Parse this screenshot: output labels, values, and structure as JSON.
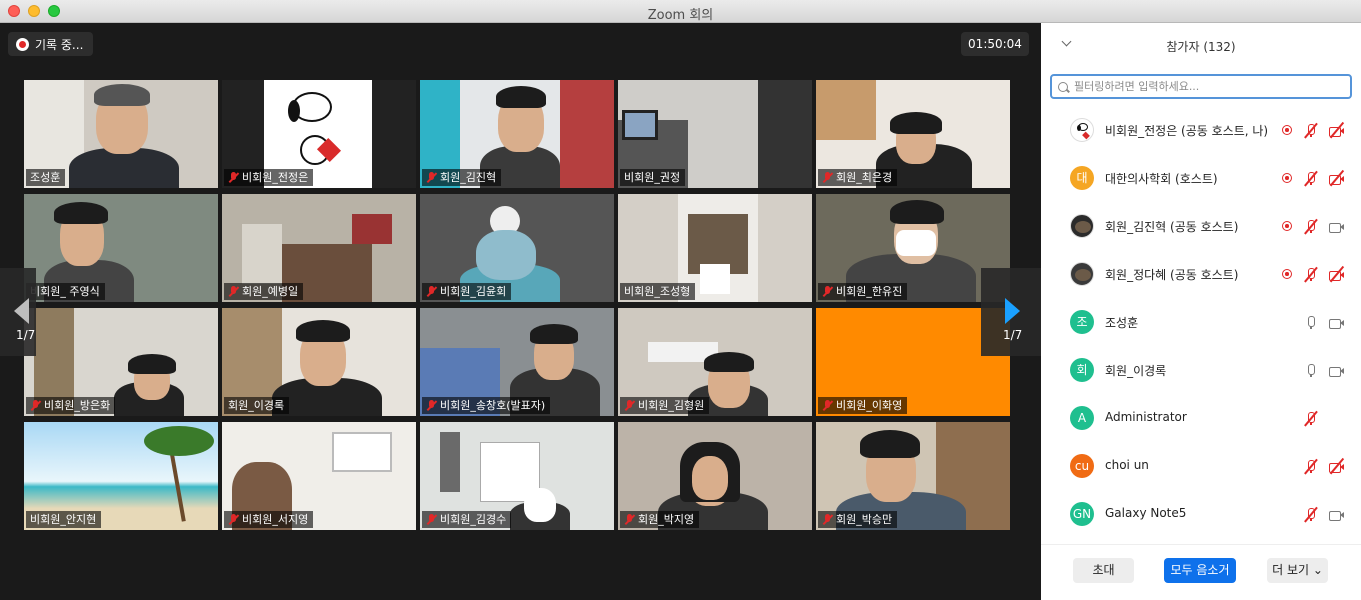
{
  "window": {
    "title": "Zoom 회의"
  },
  "meeting": {
    "recording_label": "기록 중...",
    "timer": "01:50:04",
    "page_indicator_left": "1/7",
    "page_indicator_right": "1/7",
    "tiles": [
      {
        "name": "조성훈",
        "muted": false
      },
      {
        "name": "비회원_전정은",
        "muted": true
      },
      {
        "name": "회원_김진혁",
        "muted": true
      },
      {
        "name": "비회원_권정",
        "muted": false
      },
      {
        "name": "회원_최은경",
        "muted": true
      },
      {
        "name": "비회원_ 주영식",
        "muted": false
      },
      {
        "name": "회원_예병일",
        "muted": true
      },
      {
        "name": "비회원_김윤회",
        "muted": true
      },
      {
        "name": "비회원_조성형",
        "muted": false
      },
      {
        "name": "비회원_한유진",
        "muted": true
      },
      {
        "name": "비회원_방은화",
        "muted": true
      },
      {
        "name": "회원_이경록",
        "muted": false
      },
      {
        "name": "비회원_송창호(발표자)",
        "muted": true
      },
      {
        "name": "비회원_김형원",
        "muted": true
      },
      {
        "name": "비회원_이화영",
        "muted": true
      },
      {
        "name": "비회원_안지현",
        "muted": false
      },
      {
        "name": "비회원_서지영",
        "muted": true
      },
      {
        "name": "비회원_김경수",
        "muted": true
      },
      {
        "name": "회원_박지영",
        "muted": true
      },
      {
        "name": "회원_박승만",
        "muted": true
      }
    ]
  },
  "panel": {
    "title": "참가자 (132)",
    "search_placeholder": "필터링하려면 입력하세요...",
    "participants": [
      {
        "avatar_text": "",
        "avatar_color": "#ffffff",
        "name": "비회원_전정은 (공동 호스트, 나)",
        "rec": true,
        "mic": "muted",
        "cam": "off"
      },
      {
        "avatar_text": "대",
        "avatar_color": "#f5a623",
        "name": "대한의사학회 (호스트)",
        "rec": true,
        "mic": "muted",
        "cam": "off"
      },
      {
        "avatar_text": "",
        "avatar_color": "#2b2b2b",
        "name": "회원_김진혁 (공동 호스트)",
        "rec": true,
        "mic": "muted",
        "cam": "on"
      },
      {
        "avatar_text": "",
        "avatar_color": "#3a3a3a",
        "name": "회원_정다혜 (공동 호스트)",
        "rec": true,
        "mic": "muted",
        "cam": "off"
      },
      {
        "avatar_text": "조",
        "avatar_color": "#1fbf8f",
        "name": "조성훈",
        "rec": false,
        "mic": "on",
        "cam": "on"
      },
      {
        "avatar_text": "회",
        "avatar_color": "#1fbf8f",
        "name": "회원_이경록",
        "rec": false,
        "mic": "on",
        "cam": "on"
      },
      {
        "avatar_text": "A",
        "avatar_color": "#1fbf8f",
        "name": "Administrator",
        "rec": false,
        "mic": "muted",
        "cam": "none"
      },
      {
        "avatar_text": "cu",
        "avatar_color": "#f06b14",
        "name": "choi un",
        "rec": false,
        "mic": "muted",
        "cam": "off"
      },
      {
        "avatar_text": "GN",
        "avatar_color": "#1fbf8f",
        "name": "Galaxy Note5",
        "rec": false,
        "mic": "muted",
        "cam": "on"
      }
    ],
    "footer": {
      "invite_label": "초대",
      "mute_all_label": "모두 음소거",
      "more_label": "더 보기"
    }
  }
}
